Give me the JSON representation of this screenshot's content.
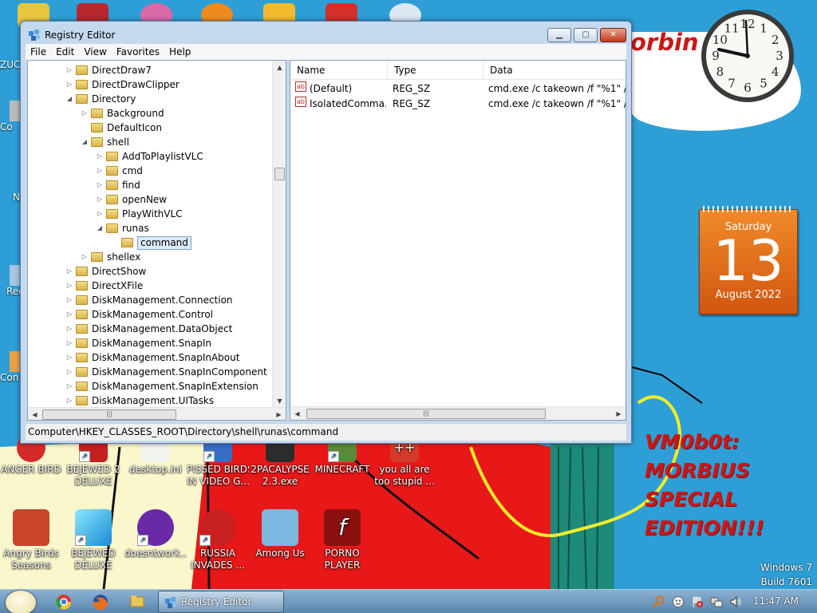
{
  "window": {
    "title": "Registry Editor",
    "menu": [
      "File",
      "Edit",
      "View",
      "Favorites",
      "Help"
    ],
    "tree": [
      {
        "label": "DirectDraw7",
        "depth": 0,
        "state": "collapsed"
      },
      {
        "label": "DirectDrawClipper",
        "depth": 0,
        "state": "collapsed"
      },
      {
        "label": "Directory",
        "depth": 0,
        "state": "expanded"
      },
      {
        "label": "Background",
        "depth": 1,
        "state": "collapsed"
      },
      {
        "label": "DefaultIcon",
        "depth": 1,
        "state": "leaf"
      },
      {
        "label": "shell",
        "depth": 1,
        "state": "expanded"
      },
      {
        "label": "AddToPlaylistVLC",
        "depth": 2,
        "state": "collapsed"
      },
      {
        "label": "cmd",
        "depth": 2,
        "state": "collapsed"
      },
      {
        "label": "find",
        "depth": 2,
        "state": "collapsed"
      },
      {
        "label": "openNew",
        "depth": 2,
        "state": "collapsed"
      },
      {
        "label": "PlayWithVLC",
        "depth": 2,
        "state": "collapsed"
      },
      {
        "label": "runas",
        "depth": 2,
        "state": "expanded"
      },
      {
        "label": "command",
        "depth": 3,
        "state": "leaf",
        "selected": true
      },
      {
        "label": "shellex",
        "depth": 1,
        "state": "collapsed"
      },
      {
        "label": "DirectShow",
        "depth": 0,
        "state": "collapsed"
      },
      {
        "label": "DirectXFile",
        "depth": 0,
        "state": "collapsed"
      },
      {
        "label": "DiskManagement.Connection",
        "depth": 0,
        "state": "collapsed"
      },
      {
        "label": "DiskManagement.Control",
        "depth": 0,
        "state": "collapsed"
      },
      {
        "label": "DiskManagement.DataObject",
        "depth": 0,
        "state": "collapsed"
      },
      {
        "label": "DiskManagement.SnapIn",
        "depth": 0,
        "state": "collapsed"
      },
      {
        "label": "DiskManagement.SnapInAbout",
        "depth": 0,
        "state": "collapsed"
      },
      {
        "label": "DiskManagement.SnapInComponent",
        "depth": 0,
        "state": "collapsed"
      },
      {
        "label": "DiskManagement.SnapInExtension",
        "depth": 0,
        "state": "collapsed"
      },
      {
        "label": "DiskManagement.UITasks",
        "depth": 0,
        "state": "collapsed"
      }
    ],
    "columns": [
      "Name",
      "Type",
      "Data"
    ],
    "values": [
      {
        "name": "(Default)",
        "type": "REG_SZ",
        "data": "cmd.exe /c takeown /f \"%1\" /r /d"
      },
      {
        "name": "IsolatedComma...",
        "type": "REG_SZ",
        "data": "cmd.exe /c takeown /f \"%1\" /r /d"
      }
    ],
    "status": "Computer\\HKEY_CLASSES_ROOT\\Directory\\shell\\runas\\command"
  },
  "desktop": {
    "watermark_top": "orbin",
    "watermark_text": "VM0b0t:\nMORBIUS\nSPECIAL\nEDITION!!!",
    "build_line1": "Windows 7",
    "build_line2": "Build 7601",
    "icons": [
      {
        "label": "ANGER BIRD",
        "icon": "angry-bird-icon"
      },
      {
        "label": "BEJEWED 2\nDELUXE",
        "icon": "bejeweled-icon"
      },
      {
        "label": "desktop.ini",
        "icon": "ini-file-icon"
      },
      {
        "label": "PISSED BIRDS\nIN VIDEO G...",
        "icon": "bird-video-icon"
      },
      {
        "label": "2PACALYPSE\n2.3.exe",
        "icon": "exe-icon"
      },
      {
        "label": "MINECRAFT",
        "icon": "minecraft-icon"
      },
      {
        "label": "you all are\ntoo stupid ...",
        "icon": "plus-icon"
      },
      {
        "label": "Angry Birds\nSeasons",
        "icon": "angry-birds-seasons-icon"
      },
      {
        "label": "BEJEWED\nDELUXE",
        "icon": "diamond-icon"
      },
      {
        "label": "doesntwork...",
        "icon": "yahoo-messenger-icon"
      },
      {
        "label": "RUSSIA\nINVADES ...",
        "icon": "radiation-icon"
      },
      {
        "label": "Among Us",
        "icon": "among-us-icon"
      },
      {
        "label": "PORNO\nPLAYER",
        "icon": "flash-player-icon"
      }
    ],
    "edge_labels": [
      "ZUC",
      "Co",
      "N",
      "Rec",
      "Con"
    ]
  },
  "calendar": {
    "day": "Saturday",
    "date": "13",
    "month": "August 2022"
  },
  "clock": {
    "numerals": [
      "12",
      "1",
      "2",
      "3",
      "4",
      "5",
      "6",
      "7",
      "8",
      "9",
      "10",
      "11"
    ],
    "time": "11:47"
  },
  "taskbar": {
    "active_task": "Registry Editor",
    "time": "11:47 AM",
    "colors": {
      "accent": "#5b86ad",
      "close_red": "#c23a1e"
    }
  }
}
